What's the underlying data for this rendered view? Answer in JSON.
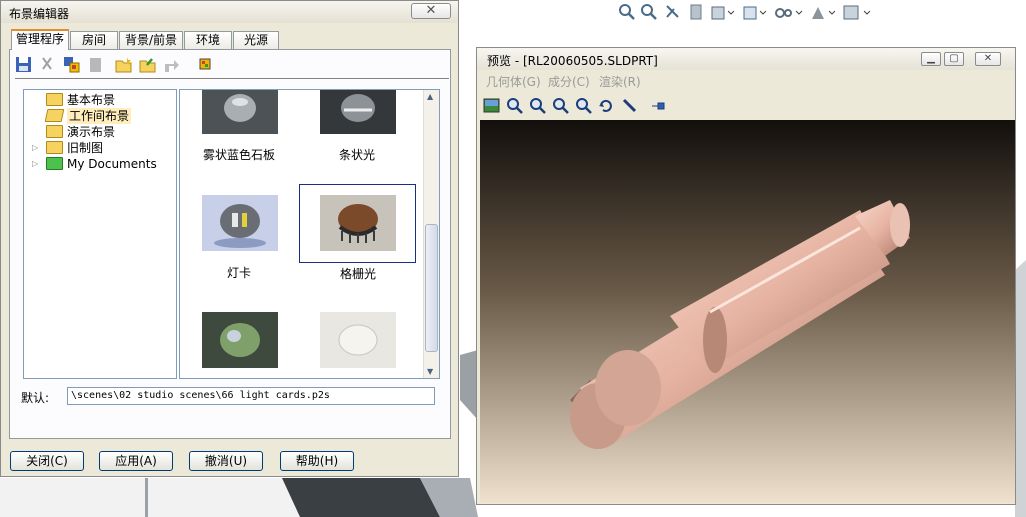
{
  "editor": {
    "title": "布景编辑器",
    "tabs": [
      "管理程序",
      "房间",
      "背景/前景",
      "环境",
      "光源"
    ],
    "tree": [
      "基本布景",
      "工作间布景",
      "演示布景",
      "旧制图",
      "My Documents"
    ],
    "scenes": [
      "雾状蓝色石板",
      "条状光",
      "灯卡",
      "格栅光"
    ],
    "default_label": "默认:",
    "default_value": "\\scenes\\02 studio scenes\\66 light cards.p2s",
    "buttons": [
      "关闭(C)",
      "应用(A)",
      "撤消(U)",
      "帮助(H)"
    ]
  },
  "preview": {
    "title": "预览 - [RL20060505.SLDPRT]",
    "menus": [
      "几何体(G)",
      "成分(C)",
      "渲染(R)"
    ]
  },
  "colors": {
    "accent": "#e68b2c",
    "selection": "#1c2d87",
    "tree_selected": "#ffeebb"
  }
}
